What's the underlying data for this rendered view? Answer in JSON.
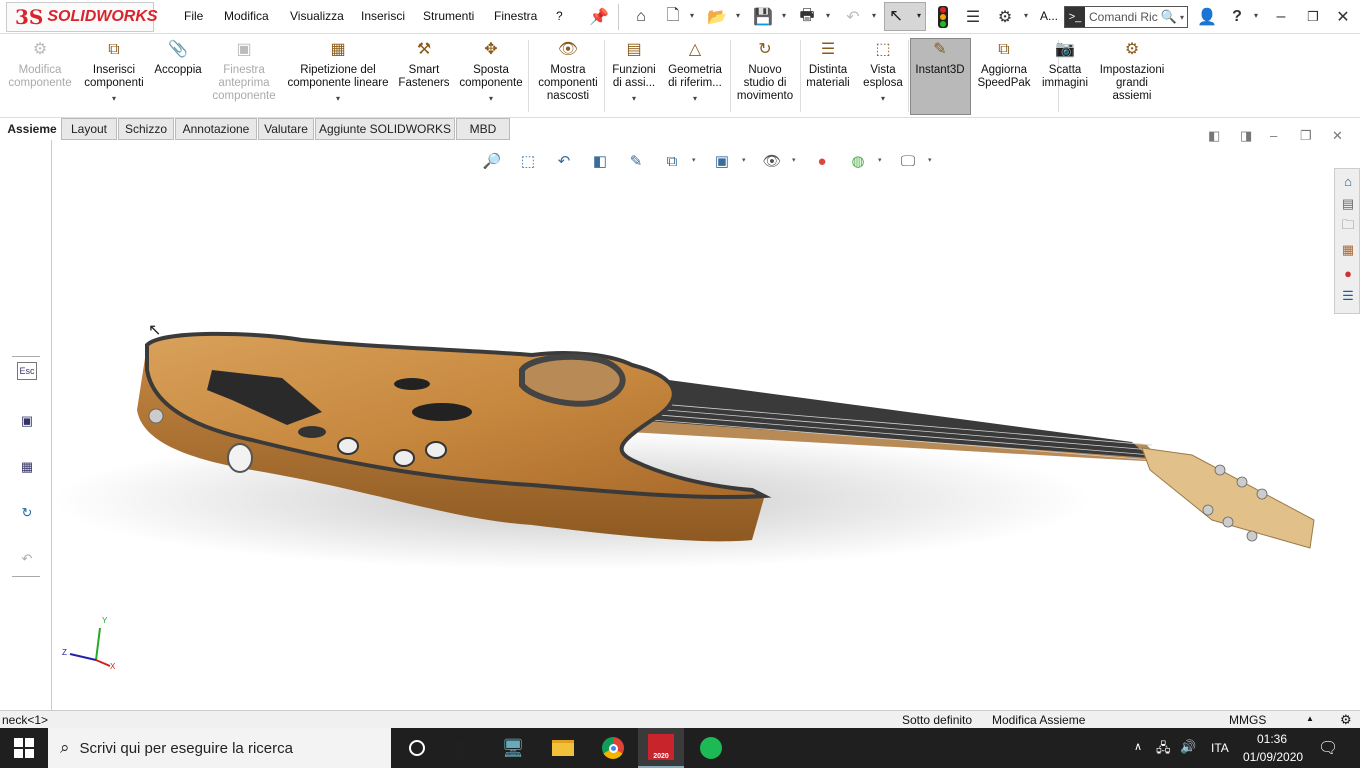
{
  "app": {
    "logo_ds": "3S",
    "logo_text": "SOLIDWORKS"
  },
  "menu": [
    "File",
    "Modifica",
    "Visualizza",
    "Inserisci",
    "Strumenti",
    "Finestra",
    "?"
  ],
  "quickbar": {
    "truncated_label": "A...",
    "search_placeholder": "Comandi Ric"
  },
  "commands": [
    {
      "label": "Modifica\ncomponente",
      "enabled": false,
      "icon": "edit-component-icon"
    },
    {
      "label": "Inserisci\ncomponenti",
      "enabled": true,
      "icon": "insert-components-icon"
    },
    {
      "label": "Accoppia",
      "enabled": true,
      "icon": "mate-paperclip-icon"
    },
    {
      "label": "Finestra\nanteprima\ncomponente",
      "enabled": false,
      "icon": "preview-window-icon"
    },
    {
      "label": "Ripetizione del\ncomponente lineare",
      "enabled": true,
      "icon": "linear-pattern-icon"
    },
    {
      "label": "Smart\nFasteners",
      "enabled": true,
      "icon": "smart-fasteners-icon"
    },
    {
      "label": "Sposta\ncomponente",
      "enabled": true,
      "icon": "move-component-icon"
    },
    {
      "label": "Mostra\ncomponenti\nnascosti",
      "enabled": true,
      "icon": "show-hidden-icon"
    },
    {
      "label": "Funzioni\ndi assi...",
      "enabled": true,
      "icon": "assembly-features-icon"
    },
    {
      "label": "Geometria\ndi riferim...",
      "enabled": true,
      "icon": "reference-geometry-icon"
    },
    {
      "label": "Nuovo\nstudio di\nmovimento",
      "enabled": true,
      "icon": "motion-study-icon"
    },
    {
      "label": "Distinta\nmateriali",
      "enabled": true,
      "icon": "bom-icon"
    },
    {
      "label": "Vista\nesplosa",
      "enabled": true,
      "icon": "exploded-view-icon"
    },
    {
      "label": "Instant3D",
      "enabled": true,
      "icon": "instant3d-icon"
    },
    {
      "label": "Aggiorna\nSpeedPak",
      "enabled": true,
      "icon": "speedpak-icon"
    },
    {
      "label": "Scatta\nimmagini",
      "enabled": true,
      "icon": "camera-icon"
    },
    {
      "label": "Impostazioni\ngrandi\nassiemi",
      "enabled": true,
      "icon": "large-assembly-icon"
    }
  ],
  "tabs": [
    "Assieme",
    "Layout",
    "Schizzo",
    "Annotazione",
    "Valutare",
    "Aggiunte SOLIDWORKS",
    "MBD"
  ],
  "left_panel": {
    "esc_label": "Esc"
  },
  "triad": {
    "x": "X",
    "y": "Y",
    "z": "Z"
  },
  "status": {
    "left": "neck<1>",
    "state": "Sotto definito",
    "mode": "Modifica Assieme",
    "units": "MMGS"
  },
  "taskbar": {
    "search_placeholder": "Scrivi qui per eseguire la ricerca",
    "sw_badge": "2020",
    "language": "ITA",
    "time": "01:36",
    "date": "01/09/2020"
  },
  "colors": {
    "brand_red": "#d8242c",
    "wood": "#c7883f",
    "wood_dark": "#8e5a22",
    "taskbar": "#1f1f1f"
  }
}
